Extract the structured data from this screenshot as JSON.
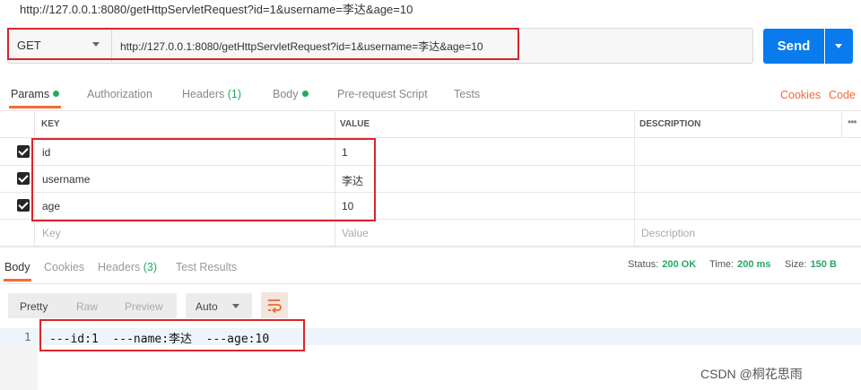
{
  "window": {
    "title": "http://127.0.0.1:8080/getHttpServletRequest?id=1&username=李达&age=10"
  },
  "request": {
    "method": "GET",
    "url": "http://127.0.0.1:8080/getHttpServletRequest?id=1&username=李达&age=10",
    "send_label": "Send"
  },
  "request_tabs": [
    {
      "label": "Params",
      "dot": true
    },
    {
      "label": "Authorization"
    },
    {
      "label": "Headers",
      "count": "(1)"
    },
    {
      "label": "Body",
      "dot": true
    },
    {
      "label": "Pre-request Script"
    },
    {
      "label": "Tests"
    }
  ],
  "links": {
    "cookies": "Cookies",
    "code": "Code"
  },
  "params_table": {
    "headers": [
      "KEY",
      "VALUE",
      "DESCRIPTION"
    ],
    "rows": [
      {
        "key": "id",
        "value": "1",
        "checked": true
      },
      {
        "key": "username",
        "value": "李达",
        "checked": true
      },
      {
        "key": "age",
        "value": "10",
        "checked": true
      }
    ],
    "placeholders": {
      "key": "Key",
      "value": "Value",
      "description": "Description"
    }
  },
  "response_tabs": [
    {
      "label": "Body"
    },
    {
      "label": "Cookies"
    },
    {
      "label": "Headers",
      "count": "(3)"
    },
    {
      "label": "Test Results"
    }
  ],
  "response_status": {
    "status_label": "Status:",
    "status_value": "200 OK",
    "time_label": "Time:",
    "time_value": "200 ms",
    "size_label": "Size:",
    "size_value": "150 B"
  },
  "body_format": {
    "buttons": [
      "Pretty",
      "Raw",
      "Preview"
    ],
    "selected": "Pretty",
    "type_select": "Auto",
    "wrap_icon": "wrap-lines-icon"
  },
  "response_body": {
    "line_number": "1",
    "line": "---id:1  ---name:李达  ---age:10"
  },
  "watermark": "CSDN @桐花思雨",
  "colors": {
    "send_button": "#097bed",
    "active_tab_underline": "#f26b3a",
    "status_ok": "#25a966",
    "highlight_box": "#d9252c"
  }
}
